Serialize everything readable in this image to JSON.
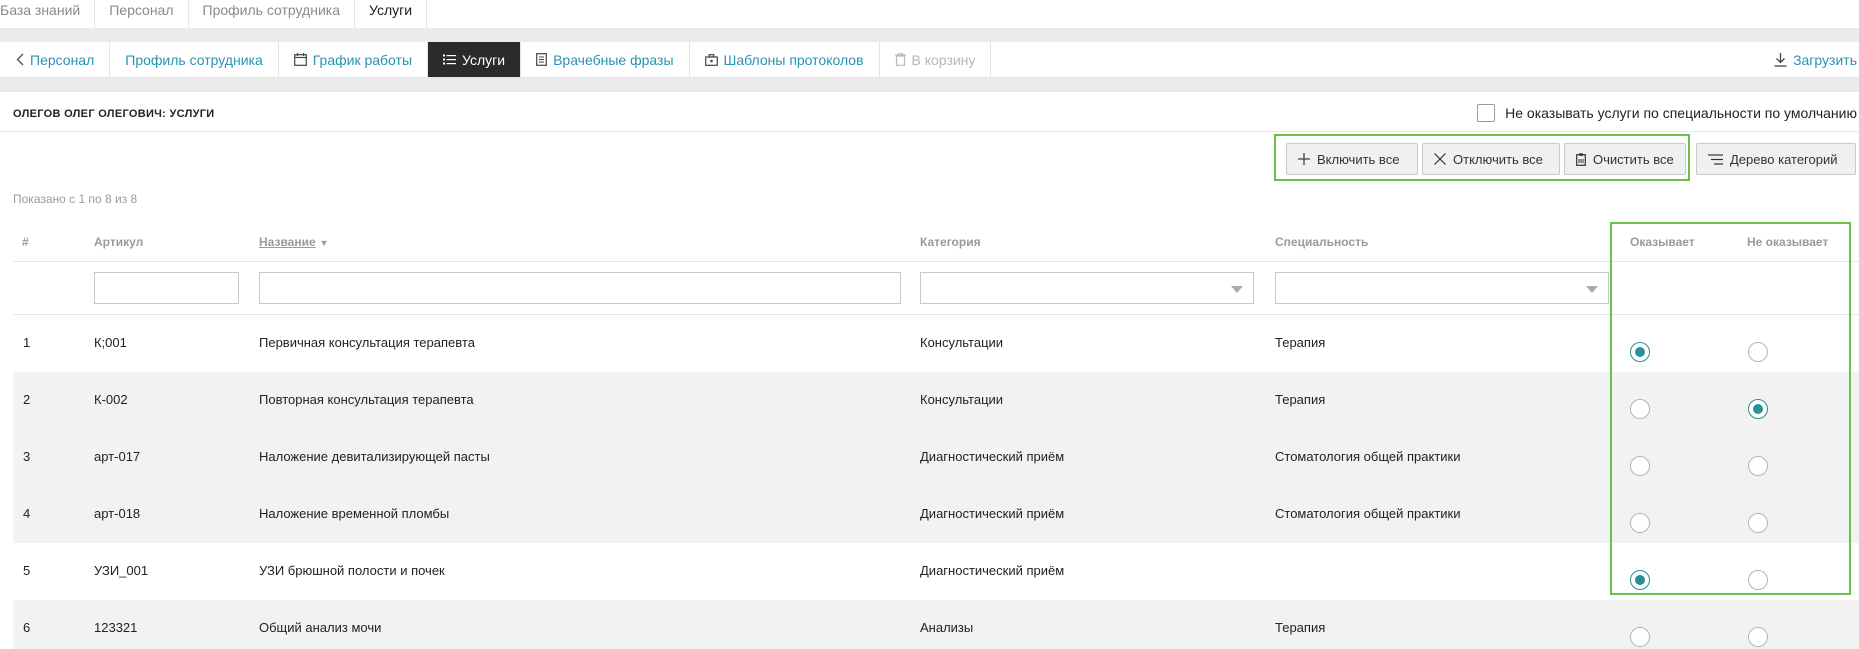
{
  "top_tabs": [
    {
      "label": "База знаний"
    },
    {
      "label": "Персонал"
    },
    {
      "label": "Профиль сотрудника"
    },
    {
      "label": "Услуги"
    }
  ],
  "subnav": {
    "back_label": "Персонал",
    "items": [
      {
        "label": "Профиль сотрудника",
        "icon": ""
      },
      {
        "label": "График работы",
        "icon": "calendar-icon"
      },
      {
        "label": "Услуги",
        "icon": "list-icon"
      },
      {
        "label": "Врачебные фразы",
        "icon": "document-icon"
      },
      {
        "label": "Шаблоны протоколов",
        "icon": "briefcase-icon"
      },
      {
        "label": "В корзину",
        "icon": "trash-icon"
      }
    ],
    "download_label": "Загрузить"
  },
  "panel": {
    "title": "ОЛЕГОВ ОЛЕГ ОЛЕГОВИЧ: УСЛУГИ",
    "default_checkbox_label": "Не оказывать услуги по специальности по умолчанию"
  },
  "actions": {
    "enable_all": "Включить все",
    "disable_all": "Отключить все",
    "clear_all": "Очистить все",
    "category_tree": "Дерево категорий"
  },
  "table": {
    "shown_info": "Показано с 1 по 8 из 8",
    "headers": {
      "num": "#",
      "article": "Артикул",
      "name": "Название",
      "category": "Категория",
      "specialty": "Специальность",
      "provides": "Оказывает",
      "not_provides": "Не оказывает"
    },
    "rows": [
      {
        "num": "1",
        "article": "К;001",
        "name": "Первичная консультация терапевта",
        "category": "Консультации",
        "specialty": "Терапия",
        "provides": true,
        "not_provides": false
      },
      {
        "num": "2",
        "article": "К-002",
        "name": "Повторная консультация терапевта",
        "category": "Консультации",
        "specialty": "Терапия",
        "provides": false,
        "not_provides": true
      },
      {
        "num": "3",
        "article": "арт-017",
        "name": "Наложение девитализирующей пасты",
        "category": "Диагностический приём",
        "specialty": "Стоматология общей практики",
        "provides": false,
        "not_provides": false
      },
      {
        "num": "4",
        "article": "арт-018",
        "name": "Наложение временной пломбы",
        "category": "Диагностический приём",
        "specialty": "Стоматология общей практики",
        "provides": false,
        "not_provides": false
      },
      {
        "num": "5",
        "article": "УЗИ_001",
        "name": "УЗИ брюшной полости и почек",
        "category": "Диагностический приём",
        "specialty": "",
        "provides": true,
        "not_provides": false
      },
      {
        "num": "6",
        "article": "123321",
        "name": "Общий анализ мочи",
        "category": "Анализы",
        "specialty": "Терапия",
        "provides": false,
        "not_provides": false
      }
    ]
  },
  "colors": {
    "accent": "#2a93b3",
    "radio_selected": "#2a8f98",
    "highlight_box": "#6cc04a",
    "active_tab_bg": "#2b2b2b"
  }
}
